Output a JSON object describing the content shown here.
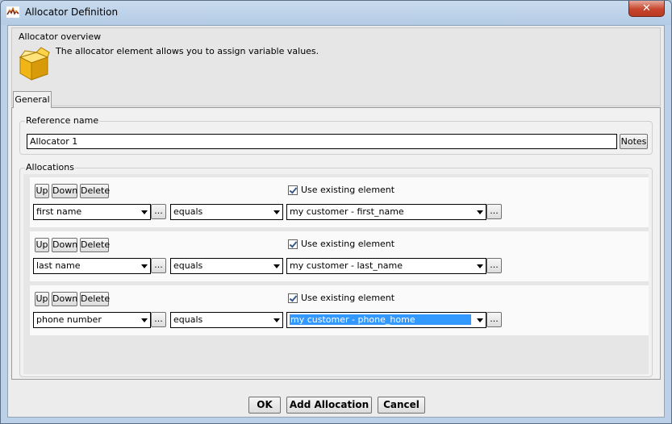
{
  "window": {
    "title": "Allocator Definition",
    "close_glyph": "✕"
  },
  "overview": {
    "label": "Allocator overview",
    "description": "The allocator element allows you to assign variable values.",
    "icon": "box-icon"
  },
  "tabs": [
    {
      "label": "General",
      "selected": true
    }
  ],
  "reference": {
    "label": "Reference name",
    "value": "Allocator 1",
    "notes_label": "Notes"
  },
  "allocations": {
    "label": "Allocations",
    "buttons": {
      "up": "Up",
      "down": "Down",
      "delete": "Delete",
      "browse": "..."
    },
    "use_existing_label": "Use existing element",
    "rows": [
      {
        "variable": "first name",
        "operator": "equals",
        "value": "my customer - first_name",
        "use_existing": true
      },
      {
        "variable": "last name",
        "operator": "equals",
        "value": "my customer - last_name",
        "use_existing": true
      },
      {
        "variable": "phone number",
        "operator": "equals",
        "value": "my customer - phone_home",
        "use_existing": true,
        "highlighted": true
      }
    ]
  },
  "footer": {
    "ok": "OK",
    "add_allocation": "Add Allocation",
    "cancel": "Cancel"
  },
  "colors": {
    "selection": "#3399ff",
    "close_button": "#c7452c",
    "frame": "#bcd1e8"
  }
}
